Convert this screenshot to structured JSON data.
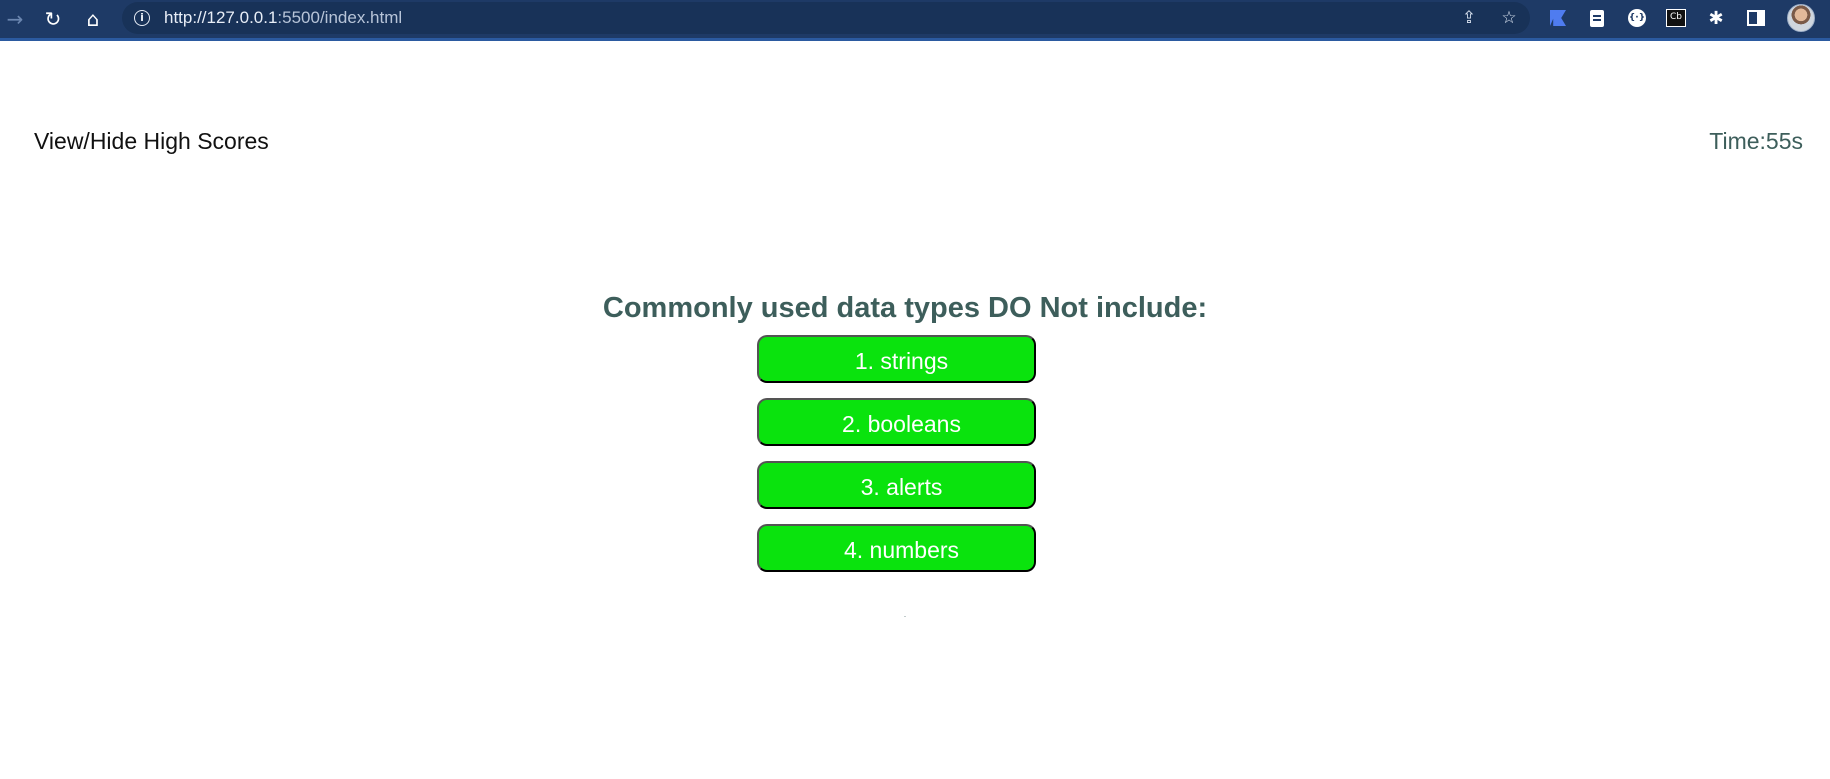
{
  "browser": {
    "url_host": "http://127.0.0.1",
    "url_rest": ":5500/index.html",
    "icons": [
      "back-icon",
      "reload-icon",
      "home-icon",
      "info-icon",
      "share-icon",
      "star-icon",
      "extension-icon",
      "puzzle-icon",
      "side-panel-icon",
      "avatar"
    ],
    "chrome_color": "#1e3a66"
  },
  "header": {
    "highscores_label": "View/Hide High Scores",
    "timer_label": "Time:55s"
  },
  "quiz": {
    "question": "Commonly used data types DO Not include:",
    "answers": [
      {
        "label": "1. strings"
      },
      {
        "label": "2. booleans"
      },
      {
        "label": "3. alerts"
      },
      {
        "label": "4. numbers"
      }
    ],
    "answer_color": "#0ae30d",
    "text_color": "#3d5e5b"
  }
}
